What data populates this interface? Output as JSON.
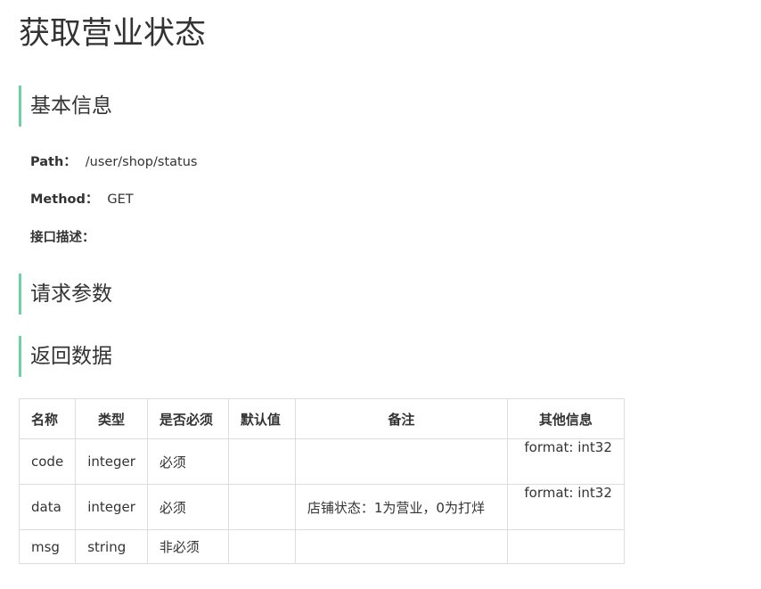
{
  "title": "获取营业状态",
  "sections": {
    "basic_info": "基本信息",
    "request_params": "请求参数",
    "response_data": "返回数据"
  },
  "info": {
    "path_label": "Path：",
    "path_value": "/user/shop/status",
    "method_label": "Method：",
    "method_value": "GET",
    "desc_label": "接口描述："
  },
  "table": {
    "headers": [
      "名称",
      "类型",
      "是否必须",
      "默认值",
      "备注",
      "其他信息"
    ],
    "rows": [
      {
        "name": "code",
        "type": "integer",
        "required": "必须",
        "default": "",
        "remark": "",
        "other": "format: int32"
      },
      {
        "name": "data",
        "type": "integer",
        "required": "必须",
        "default": "",
        "remark": "店铺状态：1为营业，0为打烊",
        "other": "format: int32"
      },
      {
        "name": "msg",
        "type": "string",
        "required": "非必须",
        "default": "",
        "remark": "",
        "other": ""
      }
    ]
  },
  "colors": {
    "accent": "#6cd2a6",
    "text": "#333333",
    "border": "#dddddd"
  }
}
